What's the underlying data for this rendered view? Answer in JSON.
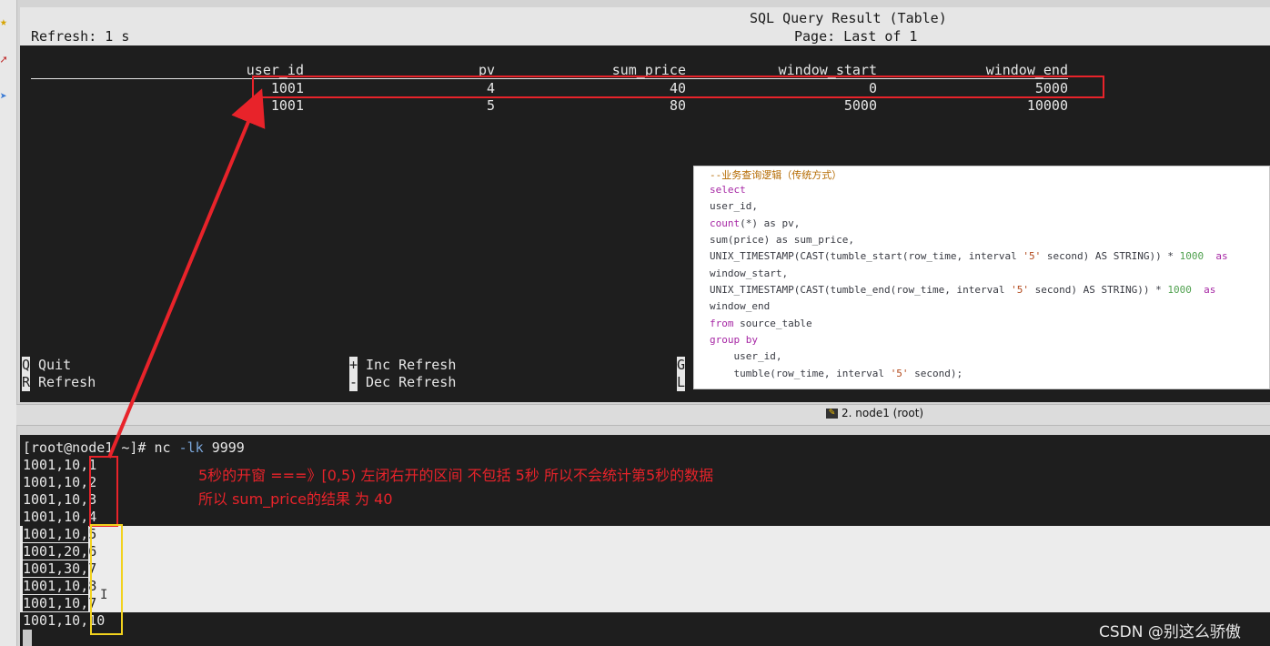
{
  "header": {
    "title": "SQL Query Result (Table)",
    "refresh": "Refresh: 1 s",
    "page": "Page: Last of 1"
  },
  "table": {
    "columns": [
      "user_id",
      "pv",
      "sum_price",
      "window_start",
      "window_end"
    ],
    "rows": [
      [
        "1001",
        "4",
        "40",
        "0",
        "5000"
      ],
      [
        "1001",
        "5",
        "80",
        "5000",
        "10000"
      ]
    ]
  },
  "keys": [
    {
      "key": "Q",
      "label": "Quit"
    },
    {
      "key": "R",
      "label": "Refresh"
    },
    {
      "key": "+",
      "label": "Inc Refresh"
    },
    {
      "key": "-",
      "label": "Dec Refresh"
    },
    {
      "key": "G",
      "label": ""
    },
    {
      "key": "L",
      "label": ""
    }
  ],
  "code": {
    "comment": "--业务查询逻辑（传统方式）",
    "select": "select",
    "l_user_id": "user_id,",
    "count_fn": "count",
    "count_rest": "(*) as pv,",
    "sum_line": "sum(price) as sum_price,",
    "ts1_a": "UNIX_TIMESTAMP(CAST(tumble_start(row_time, interval ",
    "ts1_str": "'5'",
    "ts1_b": " second) AS STRING)) * ",
    "ts1_num": "1000",
    "ts1_as": "  as",
    "ws": "window_start,",
    "ts2_a": "UNIX_TIMESTAMP(CAST(tumble_end(row_time, interval ",
    "ts2_str": "'5'",
    "ts2_b": " second) AS STRING)) * ",
    "ts2_num": "1000",
    "ts2_as": "  as",
    "we": "window_end",
    "from_kw": "from",
    "from_rest": " source_table",
    "group_kw": "group by",
    "g_user": "    user_id,",
    "g_tumble_a": "    tumble(row_time, interval ",
    "g_tumble_str": "'5'",
    "g_tumble_b": " second);"
  },
  "tab": {
    "label": "2. node1 (root)"
  },
  "shell": {
    "prompt": "[root@node1 ~]# ",
    "cmd": "nc",
    "flag": " -lk",
    "arg": " 9999",
    "lines": [
      {
        "prefix": "1001,10,",
        "val": "1"
      },
      {
        "prefix": "1001,10,",
        "val": "2"
      },
      {
        "prefix": "1001,10,",
        "val": "3"
      },
      {
        "prefix": "1001,10,",
        "val": "4"
      },
      {
        "prefix": "1001,10,",
        "val": "5"
      },
      {
        "prefix": "1001,20,",
        "val": "6"
      },
      {
        "prefix": "1001,30,",
        "val": "7"
      },
      {
        "prefix": "1001,10,",
        "val": "8"
      },
      {
        "prefix": "1001,10,",
        "val": "7"
      },
      {
        "prefix": "1001,10,",
        "val": "10"
      }
    ]
  },
  "annotation": {
    "line1": "5秒的开窗 ===》[0,5) 左闭右开的区间  不包括 5秒   所以不会统计第5秒的数据",
    "line2": "所以 sum_price的结果 为  40"
  },
  "watermark": "CSDN @别这么骄傲",
  "colors": {
    "terminal_bg": "#1e1e1e",
    "terminal_fg": "#e6e6e6",
    "annotation_red": "#e8232a",
    "annotation_yellow": "#f2d21e"
  }
}
